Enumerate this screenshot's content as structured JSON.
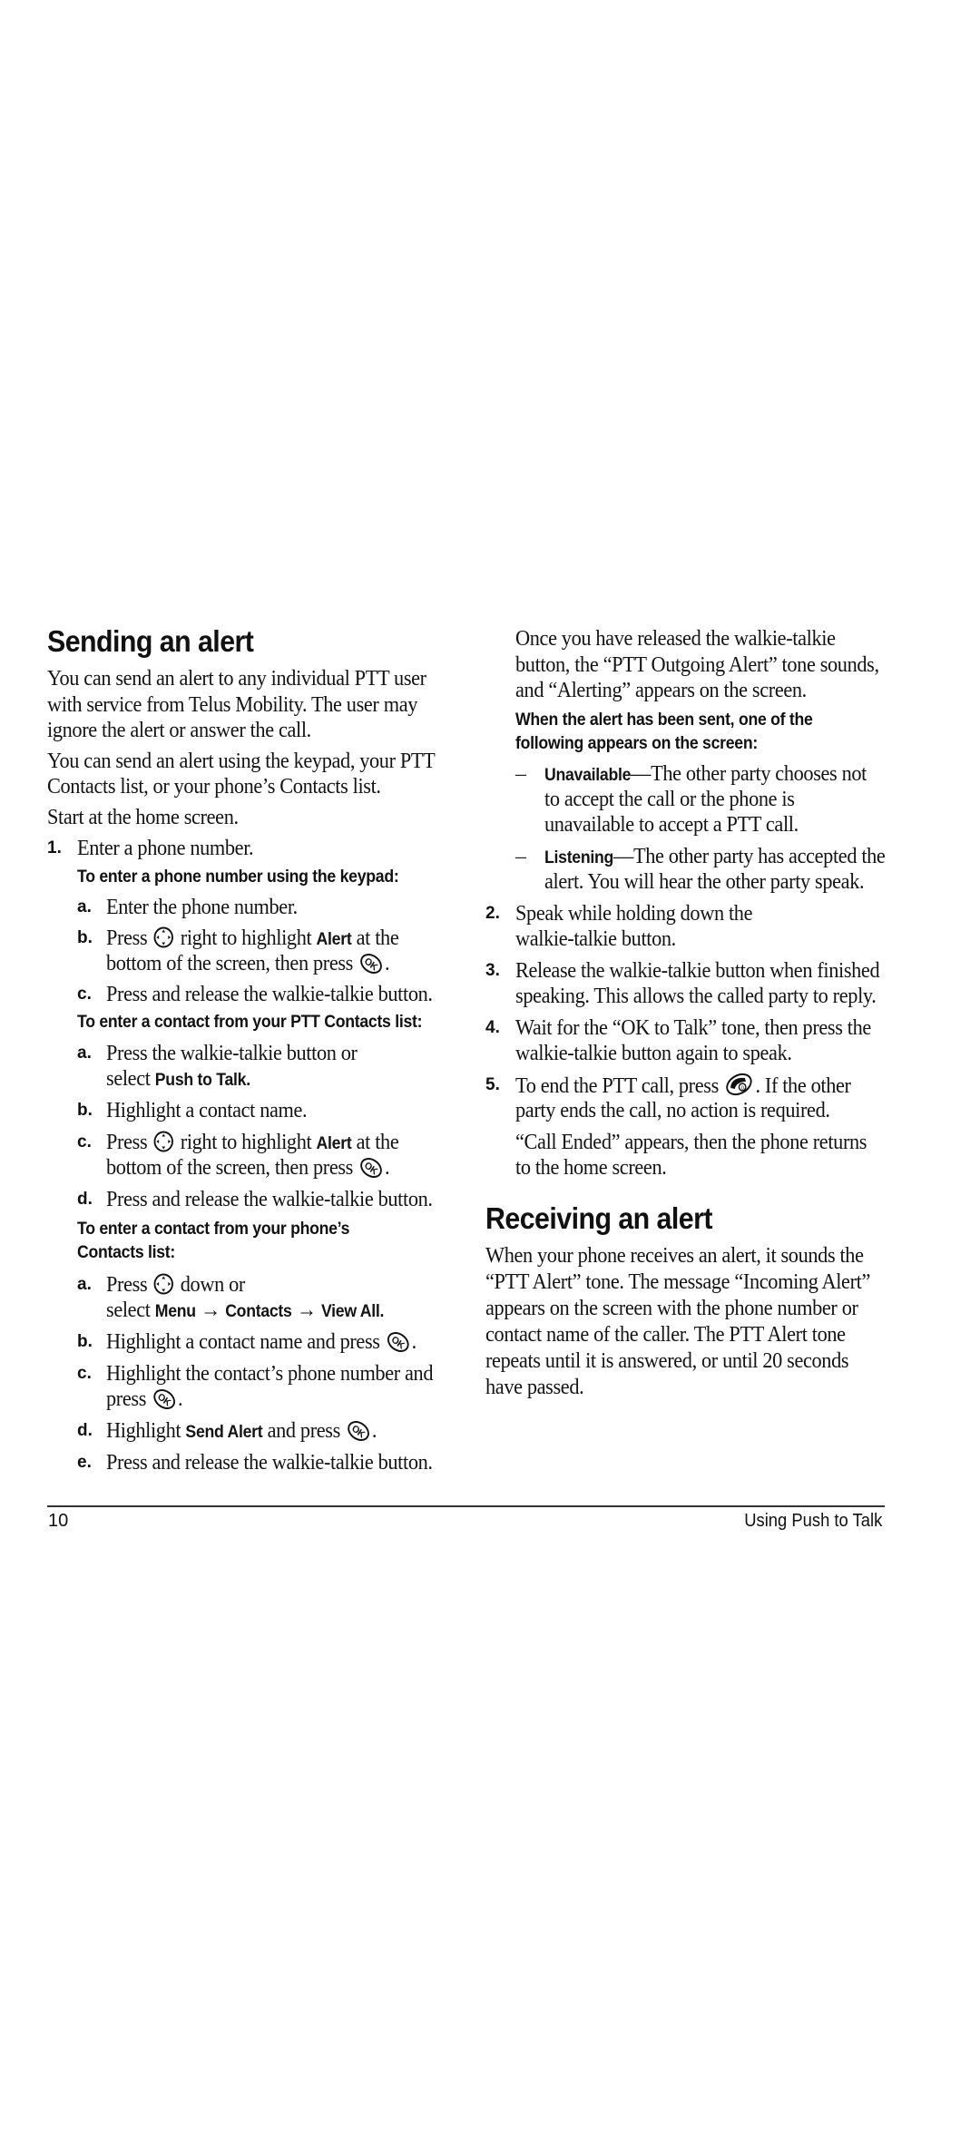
{
  "left": {
    "heading": "Sending an alert",
    "intro": [
      "You can send an alert to any individual PTT user",
      "with service from Telus Mobility. The user may",
      "ignore the alert or answer the call."
    ],
    "para2": [
      "You can send an alert using the keypad, your PTT",
      "Contacts list, or your phone’s Contacts list."
    ],
    "start": "Start at the home screen.",
    "step1": {
      "num": "1.",
      "text": "Enter a phone number."
    },
    "keypad": {
      "subheading": "To enter a phone number using the keypad:",
      "a": {
        "letter": "a.",
        "text": "Enter the phone number."
      },
      "b": {
        "letter": "b.",
        "press": "Press",
        "mid": "right to highlight",
        "bold": "Alert",
        "end": "at the",
        "line2": "bottom of the screen, then press",
        "period": "."
      },
      "c": {
        "letter": "c.",
        "text": "Press and release the walkie-talkie button."
      }
    },
    "ptt_contacts": {
      "subheading": "To enter a contact from your PTT Contacts list:",
      "a": {
        "letter": "a.",
        "line1": "Press the walkie-talkie button or",
        "select": "select",
        "bold": "Push to Talk."
      },
      "b": {
        "letter": "b.",
        "text": "Highlight a contact name."
      },
      "c": {
        "letter": "c.",
        "press": "Press",
        "mid": "right to highlight",
        "bold": "Alert",
        "end": "at the",
        "line2": "bottom of the screen, then press",
        "period": "."
      },
      "d": {
        "letter": "d.",
        "text": "Press and release the walkie-talkie button."
      }
    },
    "phone_contacts": {
      "subheading_line1": "To enter a contact from your phone’s",
      "subheading_line2": "Contacts list:",
      "a": {
        "letter": "a.",
        "press": "Press",
        "mid": "down or",
        "select": "select",
        "menu": "Menu",
        "arrow": "→",
        "contacts": "Contacts",
        "viewall": "View All."
      },
      "b": {
        "letter": "b.",
        "text": "Highlight a contact name and press",
        "period": "."
      },
      "c": {
        "letter": "c.",
        "line1": "Highlight the contact’s phone number and",
        "line2": "press",
        "period": "."
      },
      "d": {
        "letter": "d.",
        "pre": "Highlight",
        "bold": "Send Alert",
        "post": "and press",
        "period": "."
      },
      "e": {
        "letter": "e.",
        "text": "Press and release the walkie-talkie button."
      }
    }
  },
  "right": {
    "intro": [
      "Once you have released the walkie-talkie",
      "button, the “PTT Outgoing Alert” tone sounds,",
      "and “Alerting” appears on the screen."
    ],
    "subheading_line1": "When the alert has been sent, one of the",
    "subheading_line2": "following appears on the screen:",
    "bullets": [
      {
        "dash": "–",
        "bold": "Unavailable",
        "rest": "—The other party chooses not",
        "line2": "to accept the call or the phone is",
        "line3": "unavailable to accept a PTT call."
      },
      {
        "dash": "–",
        "bold": "Listening",
        "rest": "—The other party has accepted the",
        "line2": "alert. You will hear the other party speak."
      }
    ],
    "step2": {
      "num": "2.",
      "line1": "Speak while holding down the",
      "line2": "walkie-talkie button."
    },
    "step3": {
      "num": "3.",
      "line1": "Release the walkie-talkie button when finished",
      "line2": "speaking. This allows the called party to reply."
    },
    "step4": {
      "num": "4.",
      "line1": "Wait for the “OK to Talk” tone, then press the",
      "line2": "walkie-talkie button again to speak."
    },
    "step5": {
      "num": "5.",
      "pre": "To end the PTT call, press",
      "post": ". If the other",
      "line2": "party ends the call, no action is required."
    },
    "call_ended": [
      "“Call Ended” appears, then the phone returns",
      "to the home screen."
    ],
    "heading2": "Receiving an alert",
    "receiving": [
      "When your phone receives an alert, it sounds the",
      "“PTT Alert” tone. The message “Incoming Alert”",
      "appears on the screen with the phone number or",
      "contact name of the caller. The PTT Alert tone",
      "repeats until it is answered, or until 20 seconds",
      "have passed."
    ]
  },
  "footer": {
    "page_number": "10",
    "section": "Using Push to Talk"
  }
}
